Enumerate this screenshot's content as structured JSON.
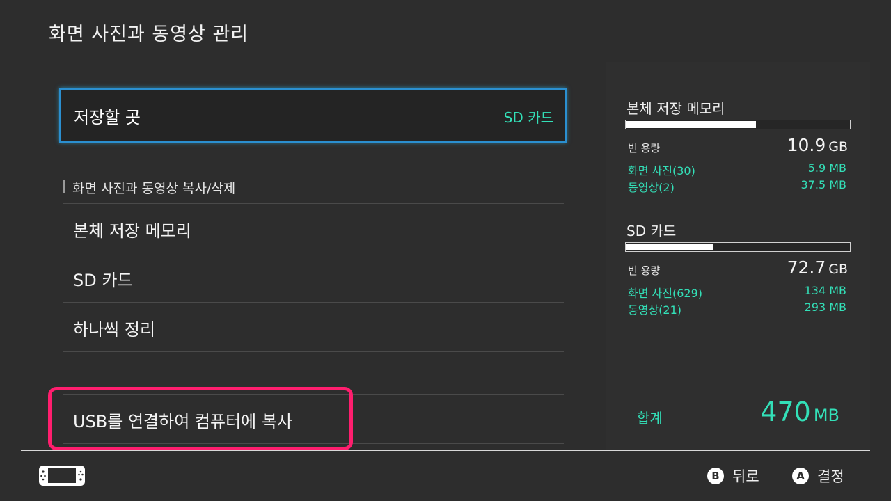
{
  "header": {
    "title": "화면 사진과 동영상 관리"
  },
  "save_location": {
    "label": "저장할 곳",
    "value": "SD 카드"
  },
  "section": {
    "title": "화면 사진과 동영상 복사/삭제"
  },
  "menu": {
    "items": [
      {
        "label": "본체 저장 메모리"
      },
      {
        "label": "SD 카드"
      },
      {
        "label": "하나씩 정리"
      }
    ],
    "usb_copy": {
      "label": "USB를 연결하여 컴퓨터에 복사"
    }
  },
  "storage": {
    "system": {
      "title": "본체 저장 메모리",
      "used_fraction": 0.58,
      "free_label": "빈 용량",
      "free_value": "10.9",
      "free_unit": "GB",
      "photos_label": "화면 사진(30)",
      "photos_size": "5.9 MB",
      "videos_label": "동영상(2)",
      "videos_size": "37.5 MB"
    },
    "sd": {
      "title": "SD 카드",
      "used_fraction": 0.39,
      "free_label": "빈 용량",
      "free_value": "72.7",
      "free_unit": "GB",
      "photos_label": "화면 사진(629)",
      "photos_size": "134 MB",
      "videos_label": "동영상(21)",
      "videos_size": "293 MB"
    },
    "total": {
      "label": "합계",
      "value": "470",
      "unit": "MB"
    }
  },
  "footer": {
    "back": {
      "key": "B",
      "label": "뒤로"
    },
    "confirm": {
      "key": "A",
      "label": "결정"
    }
  },
  "colors": {
    "accent": "#33e0b8",
    "focus": "#2b8fd0",
    "highlight": "#ff1e6e"
  },
  "icons": {
    "console": "console-handheld-icon"
  }
}
